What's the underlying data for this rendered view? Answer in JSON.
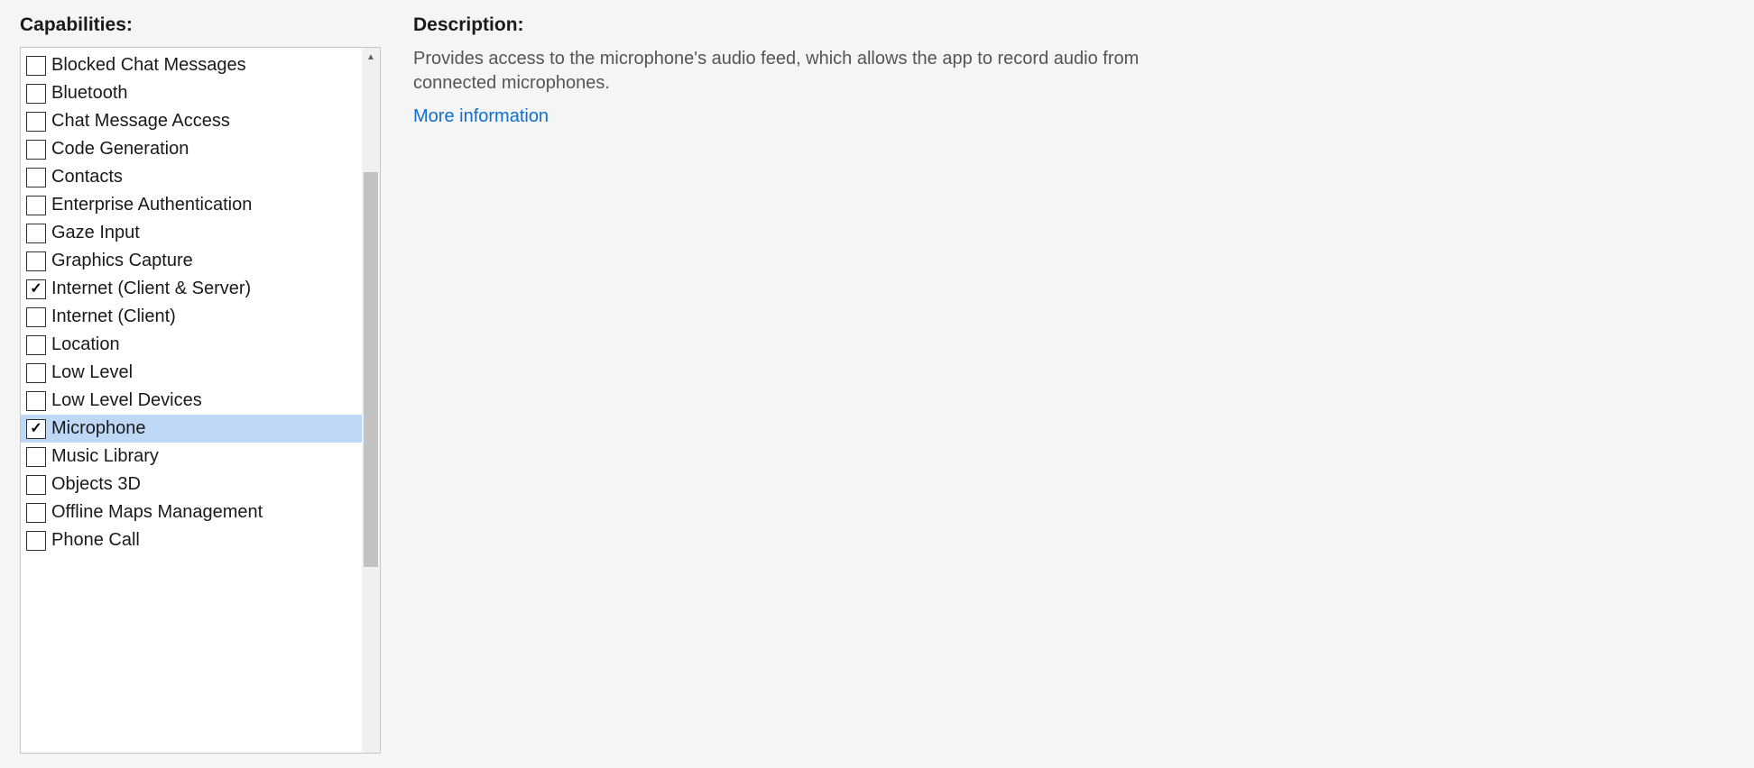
{
  "left": {
    "heading": "Capabilities:",
    "items": [
      {
        "label": "Blocked Chat Messages",
        "checked": false,
        "selected": false
      },
      {
        "label": "Bluetooth",
        "checked": false,
        "selected": false
      },
      {
        "label": "Chat Message Access",
        "checked": false,
        "selected": false
      },
      {
        "label": "Code Generation",
        "checked": false,
        "selected": false
      },
      {
        "label": "Contacts",
        "checked": false,
        "selected": false
      },
      {
        "label": "Enterprise Authentication",
        "checked": false,
        "selected": false
      },
      {
        "label": "Gaze Input",
        "checked": false,
        "selected": false
      },
      {
        "label": "Graphics Capture",
        "checked": false,
        "selected": false
      },
      {
        "label": "Internet (Client & Server)",
        "checked": true,
        "selected": false
      },
      {
        "label": "Internet (Client)",
        "checked": false,
        "selected": false
      },
      {
        "label": "Location",
        "checked": false,
        "selected": false
      },
      {
        "label": "Low Level",
        "checked": false,
        "selected": false
      },
      {
        "label": "Low Level Devices",
        "checked": false,
        "selected": false
      },
      {
        "label": "Microphone",
        "checked": true,
        "selected": true
      },
      {
        "label": "Music Library",
        "checked": false,
        "selected": false
      },
      {
        "label": "Objects 3D",
        "checked": false,
        "selected": false
      },
      {
        "label": "Offline Maps Management",
        "checked": false,
        "selected": false
      },
      {
        "label": "Phone Call",
        "checked": false,
        "selected": false
      }
    ]
  },
  "right": {
    "heading": "Description:",
    "text": "Provides access to the microphone's audio feed, which allows the app to record audio from connected microphones.",
    "link": "More information"
  }
}
